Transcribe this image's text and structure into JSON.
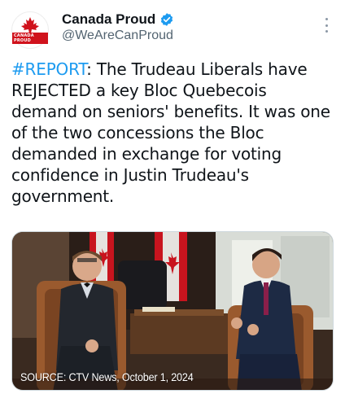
{
  "account": {
    "display_name": "Canada Proud",
    "handle": "@WeAreCanProud",
    "logo_text": "CANADA PROUD",
    "verified": true
  },
  "tweet": {
    "hashtag": "#REPORT",
    "body": ": The Trudeau Liberals have REJECTED a key Bloc Quebecois demand on seniors' benefits. It was one of the two concessions the Bloc demanded in exchange for voting confidence in Justin Trudeau's government."
  },
  "media": {
    "caption": "SOURCE: CTV News, October 1, 2024"
  },
  "icons": {
    "verified": "verified-badge-icon",
    "more": "more-options-icon",
    "logo": "maple-leaf-icon"
  },
  "colors": {
    "link": "#1d9bf0",
    "verified": "#1d9bf0",
    "brand_red": "#d0121c",
    "secondary_text": "#536471"
  }
}
